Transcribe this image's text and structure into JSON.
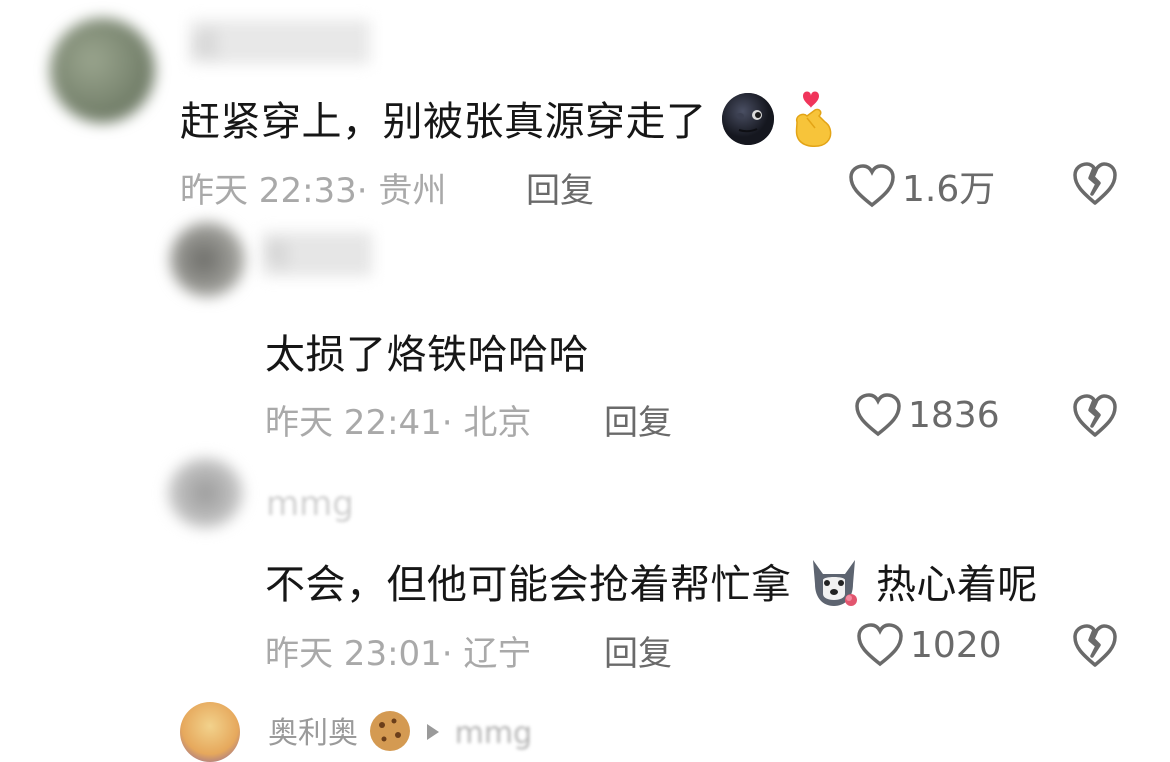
{
  "comments": [
    {
      "author": "成",
      "text": "赶紧穿上，别被张真源穿走了",
      "time": "昨天 22:33",
      "sep": "·",
      "location": "贵州",
      "reply_label": "回复",
      "likes": "1.6万",
      "emoji_1": "new-moon-face",
      "emoji_2": "finger-heart"
    },
    {
      "author": "号",
      "text": "太损了烙铁哈哈哈",
      "time": "昨天 22:41",
      "sep": "·",
      "location": "北京",
      "reply_label": "回复",
      "likes": "1836"
    },
    {
      "author": "mmg",
      "text_part1": "不会，但他可能会抢着帮忙拿",
      "text_part2": "热心着呢",
      "time": "昨天 23:01",
      "sep": "·",
      "location": "辽宁",
      "reply_label": "回复",
      "likes": "1020",
      "emoji": "husky-with-rose"
    },
    {
      "author": "奥利奥",
      "reply_to": "mmg",
      "emoji": "cookie"
    }
  ],
  "colors": {
    "text": "#161616",
    "meta": "#a9a9a9",
    "action": "#6a6a6a"
  }
}
